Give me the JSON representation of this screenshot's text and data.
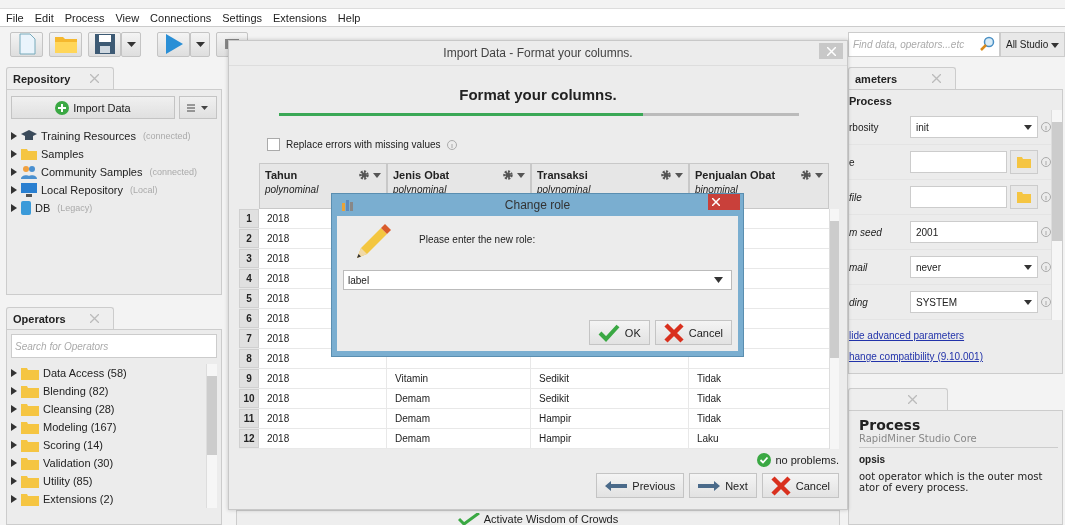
{
  "menu": [
    {
      "label": "File"
    },
    {
      "label": "Edit"
    },
    {
      "label": "Process"
    },
    {
      "label": "View"
    },
    {
      "label": "Connections"
    },
    {
      "label": "Settings"
    },
    {
      "label": "Extensions"
    },
    {
      "label": "Help"
    }
  ],
  "search": {
    "placeholder": "Find data, operators...etc",
    "scope": "All Studio"
  },
  "repository": {
    "tab": "Repository",
    "import_button": "Import Data",
    "items": [
      {
        "label": "Training Resources",
        "note": "(connected)",
        "kind": "training"
      },
      {
        "label": "Samples",
        "kind": "folder"
      },
      {
        "label": "Community Samples",
        "note": "(connected)",
        "kind": "community"
      },
      {
        "label": "Local Repository",
        "note": "(Local)",
        "kind": "local"
      },
      {
        "label": "DB",
        "note": "(Legacy)",
        "kind": "db"
      }
    ]
  },
  "operators": {
    "tab": "Operators",
    "search_placeholder": "Search for Operators",
    "items": [
      "Data Access (58)",
      "Blending (82)",
      "Cleansing (28)",
      "Modeling (167)",
      "Scoring (14)",
      "Validation (30)",
      "Utility (85)",
      "Extensions (2)"
    ]
  },
  "import_dialog": {
    "title": "Import Data - Format your columns.",
    "heading": "Format your columns.",
    "progress": {
      "level": 0.7
    },
    "replace_errors": {
      "label": "Replace errors with missing values",
      "checked": false
    },
    "columns": [
      {
        "name": "Tahun",
        "type": "polynominal"
      },
      {
        "name": "Jenis Obat",
        "type": "polynominal"
      },
      {
        "name": "Transaksi",
        "type": "polynominal"
      },
      {
        "name": "Penjualan Obat",
        "type": "binominal"
      }
    ],
    "rows": [
      {
        "number": "1",
        "cells": [
          "2018"
        ]
      },
      {
        "number": "2",
        "cells": [
          "2018"
        ]
      },
      {
        "number": "3",
        "cells": [
          "2018"
        ]
      },
      {
        "number": "4",
        "cells": [
          "2018"
        ]
      },
      {
        "number": "5",
        "cells": [
          "2018"
        ]
      },
      {
        "number": "6",
        "cells": [
          "2018"
        ]
      },
      {
        "number": "7",
        "cells": [
          "2018"
        ]
      },
      {
        "number": "8",
        "cells": [
          "2018"
        ]
      },
      {
        "number": "9",
        "cells": [
          "2018",
          "Vitamin",
          "Sedikit",
          "Tidak"
        ]
      },
      {
        "number": "10",
        "cells": [
          "2018",
          "Demam",
          "Sedikit",
          "Tidak"
        ]
      },
      {
        "number": "11",
        "cells": [
          "2018",
          "Demam",
          "Hampir",
          "Tidak"
        ]
      },
      {
        "number": "12",
        "cells": [
          "2018",
          "Demam",
          "Hampir",
          "Laku"
        ]
      }
    ],
    "status": "no problems.",
    "buttons": [
      {
        "label": "Previous",
        "kind": "previous"
      },
      {
        "label": "Next",
        "kind": "next"
      },
      {
        "label": "Cancel",
        "kind": "cancel"
      }
    ]
  },
  "role_dialog": {
    "title": "Change role",
    "prompt": "Please enter the new role:",
    "value": "label",
    "buttons": [
      {
        "label": "OK",
        "kind": "ok"
      },
      {
        "label": "Cancel",
        "kind": "cancel"
      }
    ]
  },
  "parameters": {
    "tab": "ameters",
    "heading": "Process",
    "rows": [
      {
        "label": "rbosity",
        "kind": "select",
        "value": "init",
        "expert": false
      },
      {
        "label": "e",
        "kind": "file",
        "expert": false
      },
      {
        "label": "file",
        "kind": "file",
        "expert": true
      },
      {
        "label": "m seed",
        "kind": "text",
        "value": "2001",
        "expert": true
      },
      {
        "label": "mail",
        "kind": "select",
        "value": "never",
        "expert": true
      },
      {
        "label": "ding",
        "kind": "select",
        "value": "SYSTEM",
        "expert": true
      }
    ],
    "links": [
      "lide advanced parameters",
      "hange compatibility (9.10.001)"
    ]
  },
  "help": {
    "title": "Process",
    "subtitle": "RapidMiner Studio Core",
    "section": "opsis",
    "lines": [
      "oot operator which is the outer most",
      "ator of every process."
    ]
  },
  "wisdom_bar": {
    "label": "Activate Wisdom of Crowds"
  }
}
